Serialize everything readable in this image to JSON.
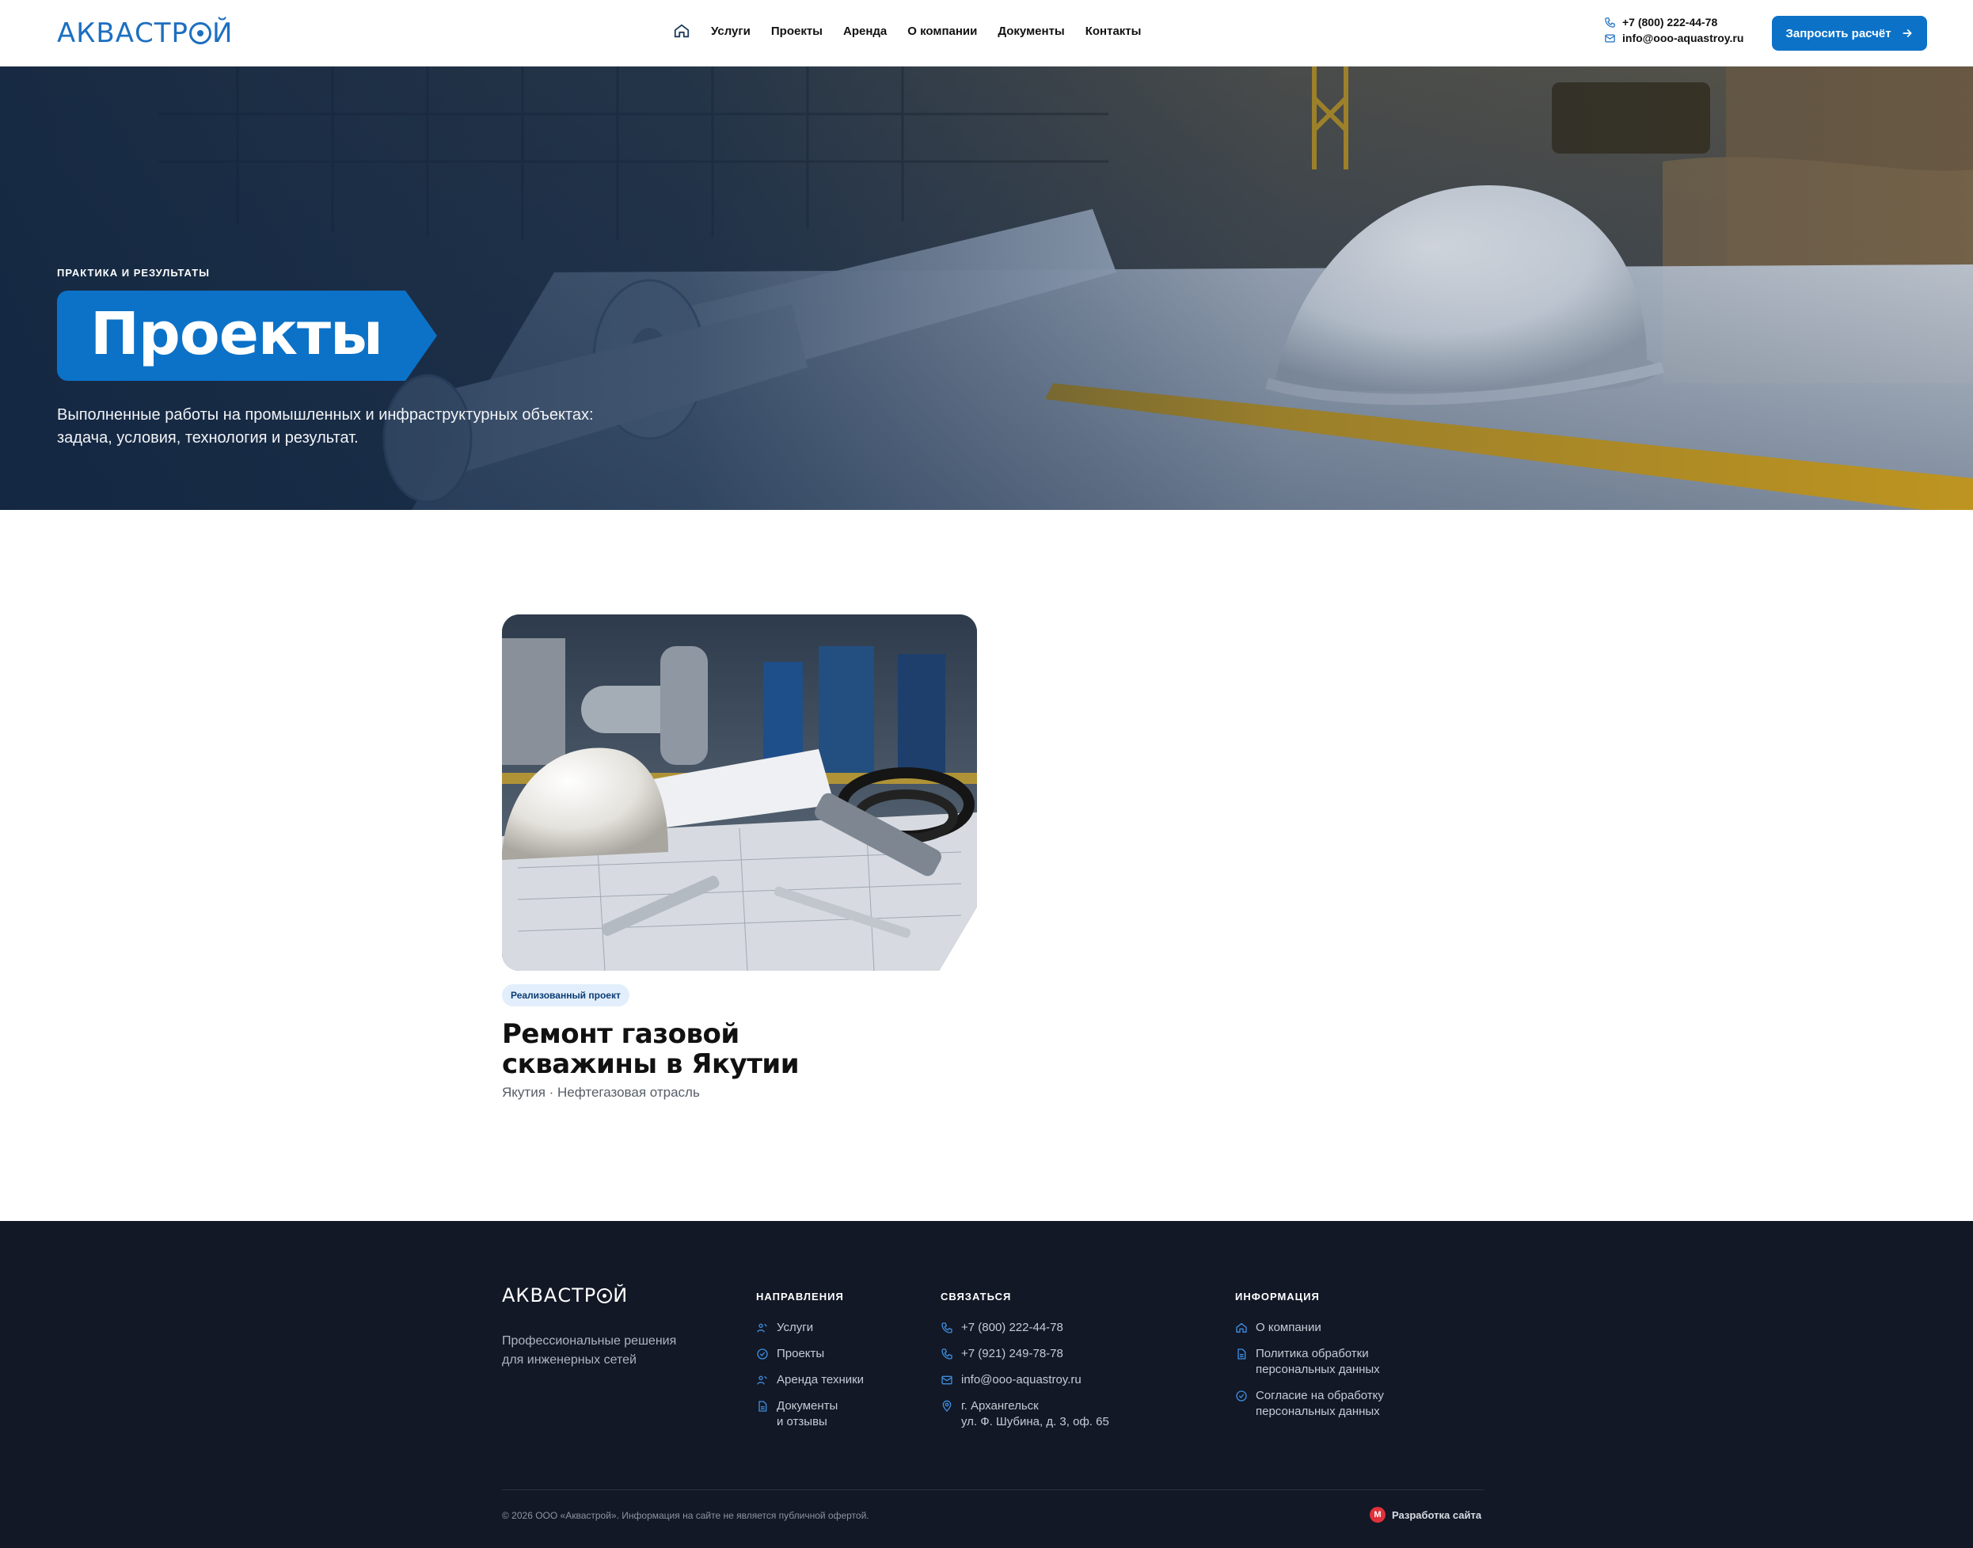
{
  "header": {
    "logo": "АКВАСТРОЙ",
    "nav": [
      "Услуги",
      "Проекты",
      "Аренда",
      "О компании",
      "Документы",
      "Контакты"
    ],
    "phone": "+7 (800) 222-44-78",
    "email": "info@ooo-aquastroy.ru",
    "cta_label": "Запросить расчёт"
  },
  "hero": {
    "eyebrow": "ПРАКТИКА И РЕЗУЛЬТАТЫ",
    "title": "Проекты",
    "subtitle_line1": "Выполненные работы на промышленных и инфраструктурных объектах:",
    "subtitle_line2": "задача, условия, технология и результат."
  },
  "project": {
    "badge": "Реализованный проект",
    "title_line1": "Ремонт газовой",
    "title_line2": "скважины в Якутии",
    "meta": "Якутия · Нефтегазовая отрасль"
  },
  "footer": {
    "logo": "АКВАСТРОЙ",
    "tagline_line1": "Профессиональные решения",
    "tagline_line2": "для инженерных сетей",
    "directions": {
      "heading": "НАПРАВЛЕНИЯ",
      "items": [
        "Услуги",
        "Проекты",
        "Аренда техники"
      ],
      "docs_line1": "Документы",
      "docs_line2": "и отзывы"
    },
    "contact": {
      "heading": "СВЯЗАТЬСЯ",
      "phone1": "+7 (800) 222-44-78",
      "phone2": "+7 (921) 249-78-78",
      "email": "info@ooo-aquastroy.ru",
      "address_line1": "г. Архангельск",
      "address_line2": "ул. Ф. Шубина, д. 3, оф. 65"
    },
    "info": {
      "heading": "ИНФОРМАЦИЯ",
      "about": "О компании",
      "policy_line1": "Политика обработки",
      "policy_line2": "персональных данных",
      "consent_line1": "Согласие на обработку",
      "consent_line2": "персональных данных"
    },
    "copyright": "© 2026 ООО «Аквастрой». Информация на сайте не является публичной офертой.",
    "dev_label": "Разработка сайта"
  },
  "colors": {
    "accent": "#0b72c8",
    "logo": "#1d6fc0",
    "footer_bg": "#121826",
    "badge_bg": "#e2eefb"
  },
  "icons": {
    "nav_home": "home-icon",
    "phone": "phone-icon",
    "email": "mail-icon",
    "cta": "arrow-right-icon",
    "footer_services": "people-icon",
    "footer_projects": "check-circle-icon",
    "footer_docs": "document-icon",
    "footer_address": "map-pin-icon",
    "dev": "dev-logo-icon"
  }
}
